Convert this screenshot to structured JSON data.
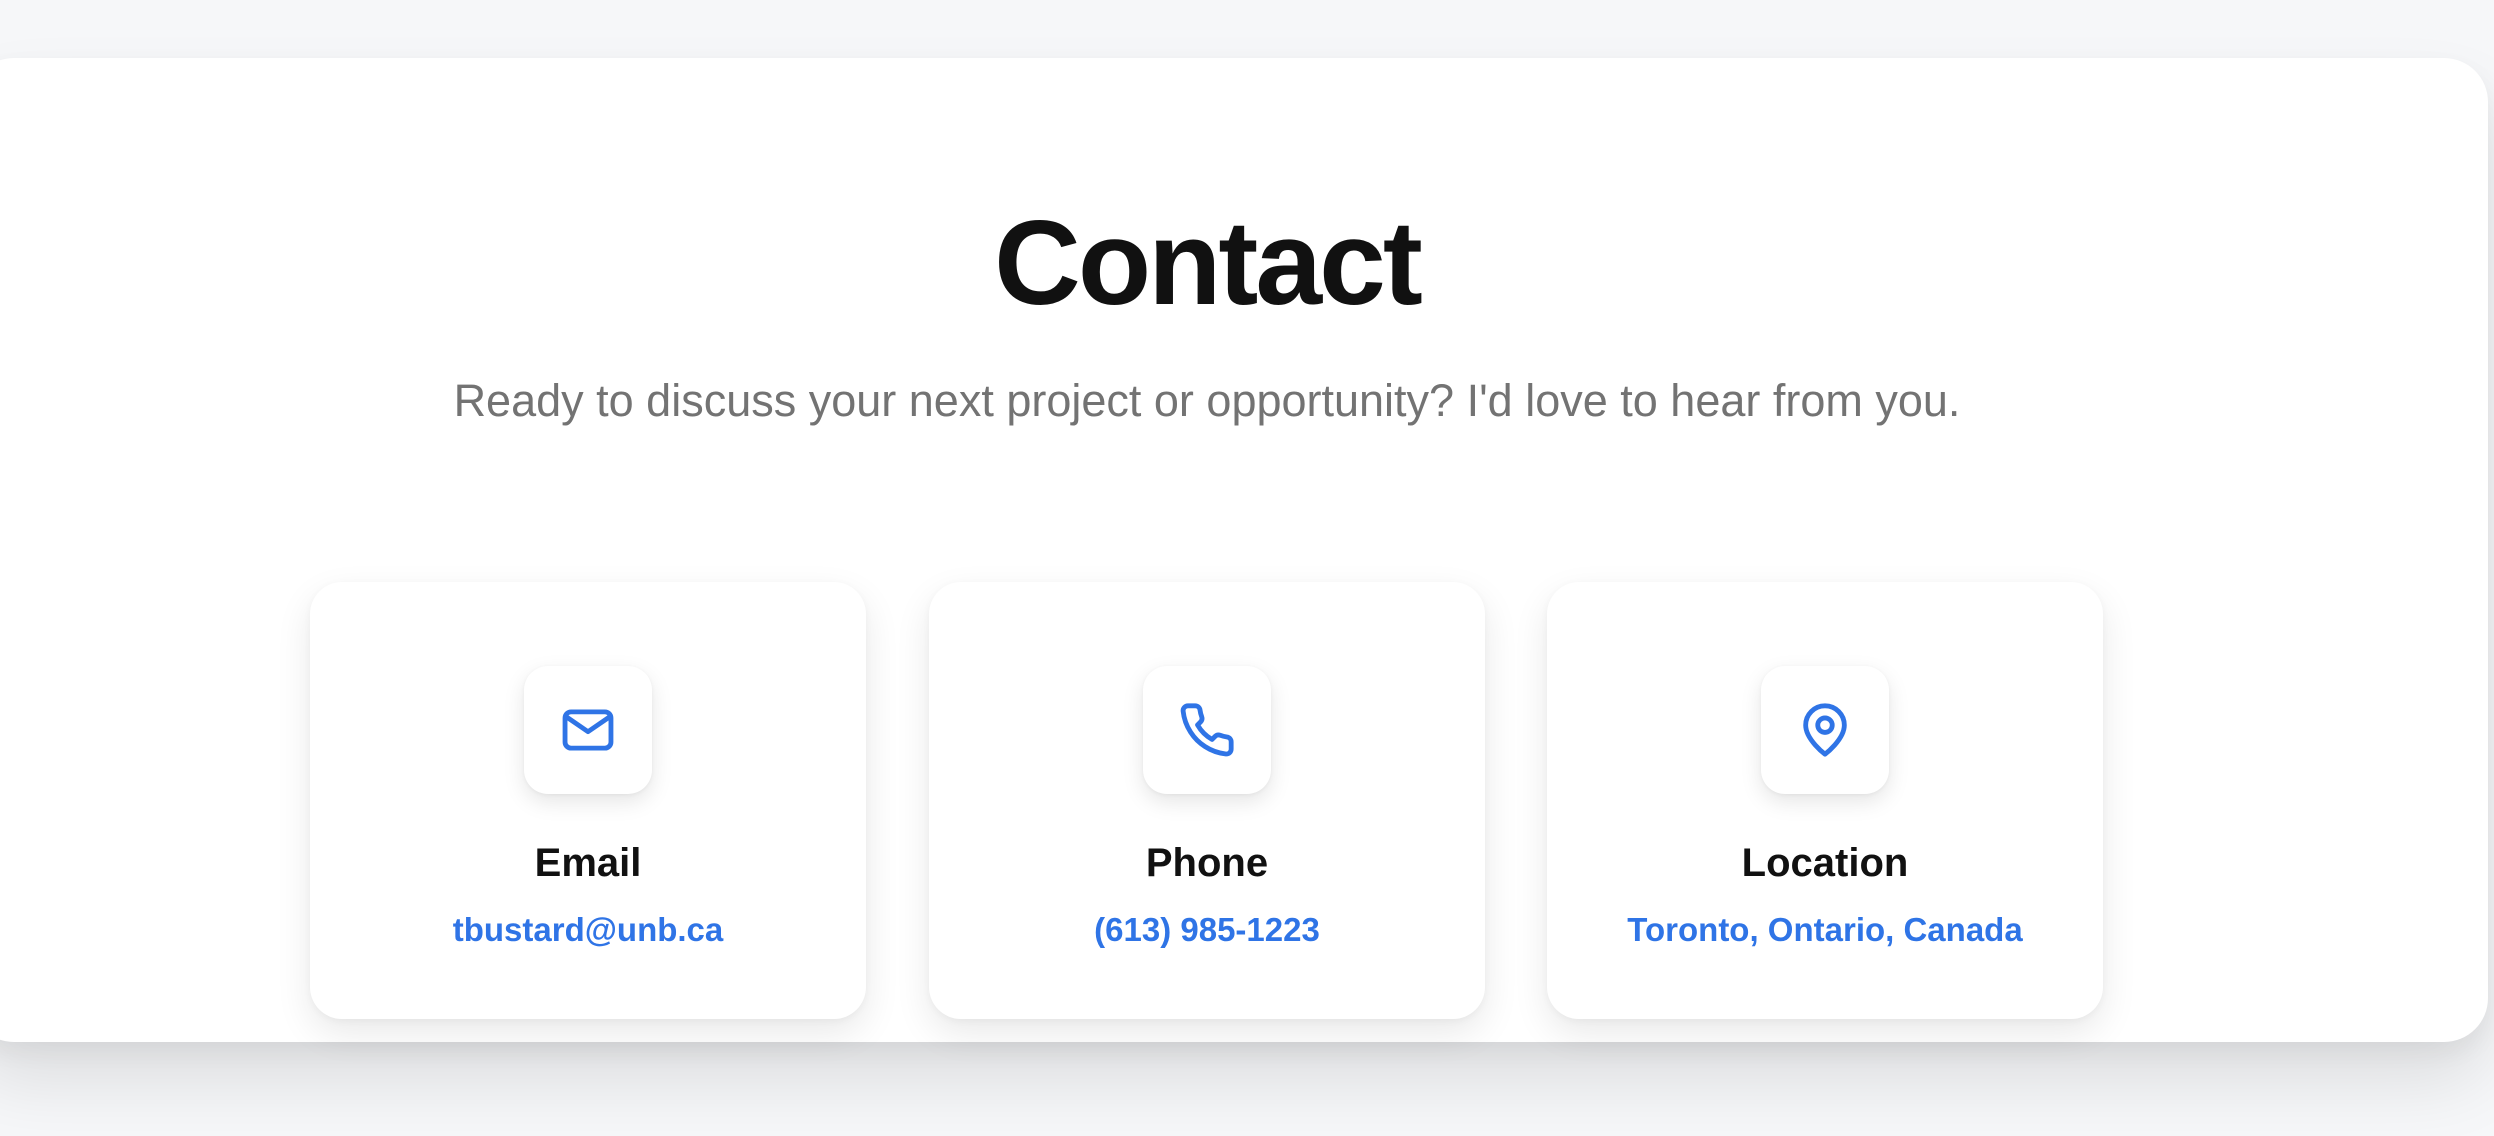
{
  "contact": {
    "title": "Contact",
    "subtitle": "Ready to discuss your next project or opportunity? I'd love to hear from you."
  },
  "cards": [
    {
      "icon": "mail-icon",
      "label": "Email",
      "value": "tbustard@unb.ca"
    },
    {
      "icon": "phone-icon",
      "label": "Phone",
      "value": "(613) 985-1223"
    },
    {
      "icon": "map-pin-icon",
      "label": "Location",
      "value": "Toronto, Ontario, Canada"
    }
  ],
  "colors": {
    "accent": "#2f74e6",
    "heading": "#111111",
    "muted": "#737373",
    "page_background": "#f6f7f9",
    "panel_background": "#ffffff"
  }
}
